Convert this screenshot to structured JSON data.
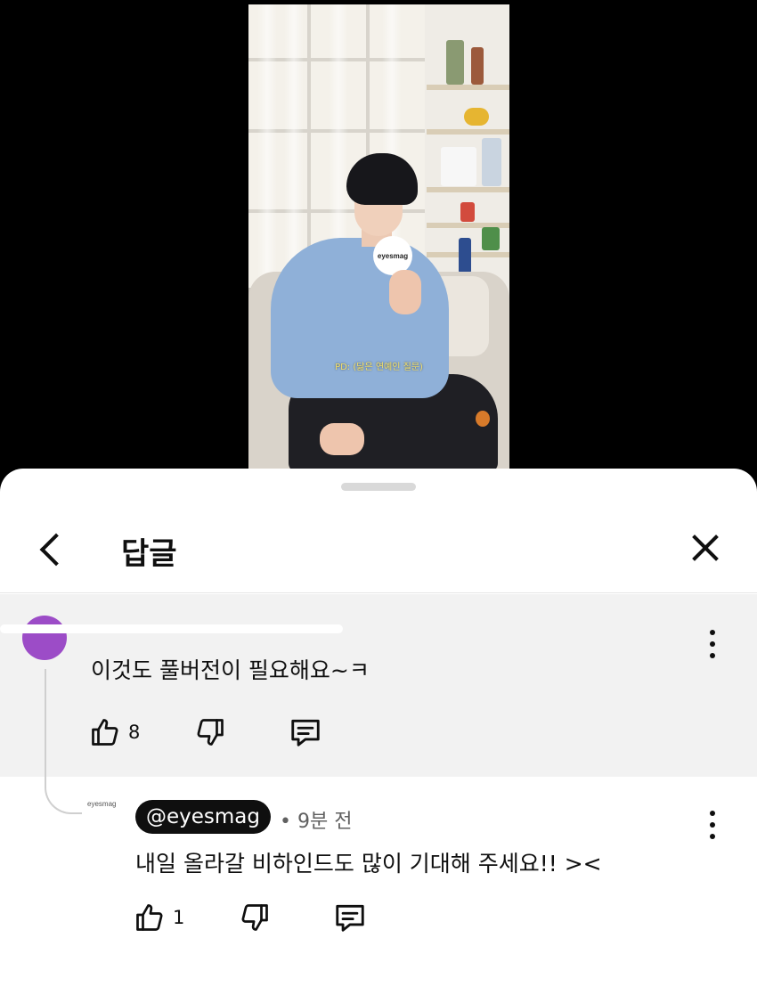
{
  "video": {
    "paddle_logo": "eyesmag",
    "caption": "PD: (닮은 연예인 질문)"
  },
  "sheet": {
    "title": "답글",
    "back_icon": "chevron-left-icon",
    "close_icon": "close-icon"
  },
  "parent_comment": {
    "author_redacted": true,
    "text": "이것도 풀버전이 필요해요~ㅋ",
    "like_count": "8",
    "avatar_color": "#9c4cc7"
  },
  "reply": {
    "avatar_label": "eyesmag",
    "handle": "@eyesmag",
    "separator": "•",
    "time": "9분 전",
    "text": "내일 올라갈 비하인드도 많이 기대해 주세요!! ><",
    "like_count": "1"
  }
}
